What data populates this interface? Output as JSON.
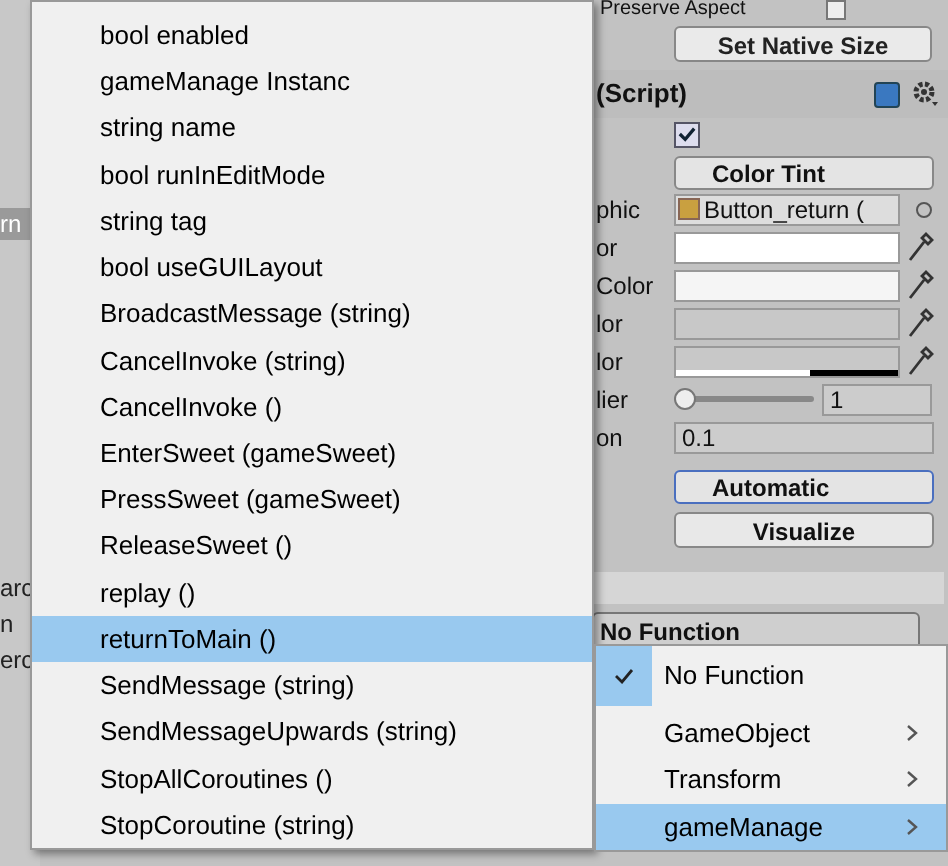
{
  "background_left": {
    "labels": [
      "rn",
      "arc",
      "n",
      "erc"
    ]
  },
  "inspector": {
    "preserve_aspect": {
      "label": "Preserve Aspect",
      "checked": false
    },
    "set_native_size": "Set Native Size",
    "component": {
      "title": "(Script)",
      "enabled": true
    },
    "transition": "Color Tint",
    "rows": [
      {
        "kind": "object",
        "label": "phic",
        "value": "Button_return ("
      },
      {
        "kind": "color",
        "label": "or",
        "color": "#ffffff"
      },
      {
        "kind": "color",
        "label": "Color",
        "color": "#f5f5f5"
      },
      {
        "kind": "color",
        "label": "lor",
        "color": "#c8c8c8"
      },
      {
        "kind": "color",
        "label": "lor",
        "color": "#c8c8c8",
        "bar": true
      },
      {
        "kind": "slider",
        "label": "lier",
        "level": 0.0,
        "value": "1"
      },
      {
        "kind": "number",
        "label": "on",
        "value": "0.1"
      }
    ],
    "navigation": "Automatic",
    "visualize": "Visualize",
    "function_dropdown": "No Function"
  },
  "method_menu": [
    {
      "label": "bool enabled",
      "selected": false
    },
    {
      "label": "gameManage Instanc",
      "selected": false
    },
    {
      "label": "string name",
      "selected": false
    },
    {
      "label": "bool runInEditMode",
      "selected": false
    },
    {
      "label": "string tag",
      "selected": false
    },
    {
      "label": "bool useGUILayout",
      "selected": false
    },
    {
      "label": "BroadcastMessage (string)",
      "selected": false
    },
    {
      "label": "CancelInvoke (string)",
      "selected": false
    },
    {
      "label": "CancelInvoke ()",
      "selected": false
    },
    {
      "label": "EnterSweet (gameSweet)",
      "selected": false
    },
    {
      "label": "PressSweet (gameSweet)",
      "selected": false
    },
    {
      "label": "ReleaseSweet ()",
      "selected": false
    },
    {
      "label": "replay ()",
      "selected": false
    },
    {
      "label": "returnToMain ()",
      "selected": true
    },
    {
      "label": "SendMessage (string)",
      "selected": false
    },
    {
      "label": "SendMessageUpwards (string)",
      "selected": false
    },
    {
      "label": "StopAllCoroutines ()",
      "selected": false
    },
    {
      "label": "StopCoroutine (string)",
      "selected": false
    }
  ],
  "function_menu": [
    {
      "label": "No Function",
      "checked": true,
      "submenu": false,
      "selected": false
    },
    {
      "label": "GameObject",
      "checked": false,
      "submenu": true,
      "selected": false
    },
    {
      "label": "Transform",
      "checked": false,
      "submenu": true,
      "selected": false
    },
    {
      "label": "gameManage",
      "checked": false,
      "submenu": true,
      "selected": true
    }
  ]
}
